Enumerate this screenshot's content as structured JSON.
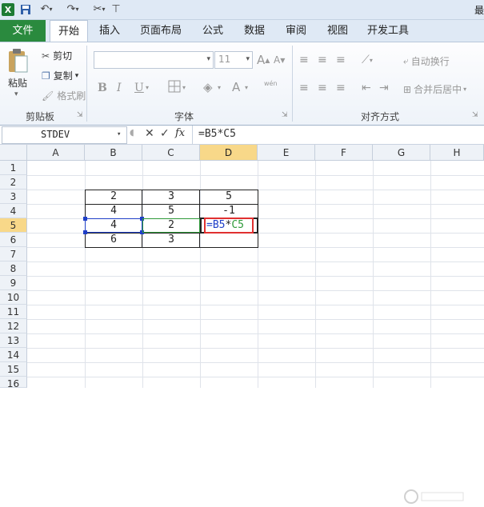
{
  "title_partial": "最",
  "ribbon": {
    "tabs": [
      "文件",
      "开始",
      "插入",
      "页面布局",
      "公式",
      "数据",
      "审阅",
      "视图",
      "开发工具"
    ],
    "clipboard": {
      "paste": "粘贴",
      "cut": "剪切",
      "copy": "复制",
      "format_painter": "格式刷",
      "label": "剪贴板"
    },
    "font": {
      "size": "11",
      "label": "字体",
      "bold": "B",
      "italic": "I",
      "underline": "U",
      "grow": "A",
      "shrink": "A",
      "color": "A",
      "wen": "wén"
    },
    "align": {
      "wrap": "自动换行",
      "merge": "合并后居中",
      "label": "对齐方式"
    }
  },
  "formula_bar": {
    "name_box": "STDEV",
    "cancel": "✕",
    "enter": "✓",
    "fx": "fx",
    "content": "=B5*C5"
  },
  "columns": [
    "A",
    "B",
    "C",
    "D",
    "E",
    "F",
    "G",
    "H"
  ],
  "rows": [
    "1",
    "2",
    "3",
    "4",
    "5",
    "6",
    "7",
    "8",
    "9",
    "10",
    "11",
    "12",
    "13",
    "14",
    "15",
    "16"
  ],
  "cells": {
    "B3": "2",
    "C3": "3",
    "D3": "5",
    "B4": "4",
    "C4": "5",
    "D4": "-1",
    "B5": "4",
    "C5": "2",
    "D5_ref1": "=B5",
    "D5_op": "*",
    "D5_ref2": "C5",
    "B6": "6",
    "C6": "3"
  },
  "colors": {
    "file_tab": "#2a8a3e",
    "selected_header": "#f8d889",
    "ref_blue": "#1f3fc8",
    "ref_green": "#2f9a3a",
    "active_red": "#e03030"
  }
}
